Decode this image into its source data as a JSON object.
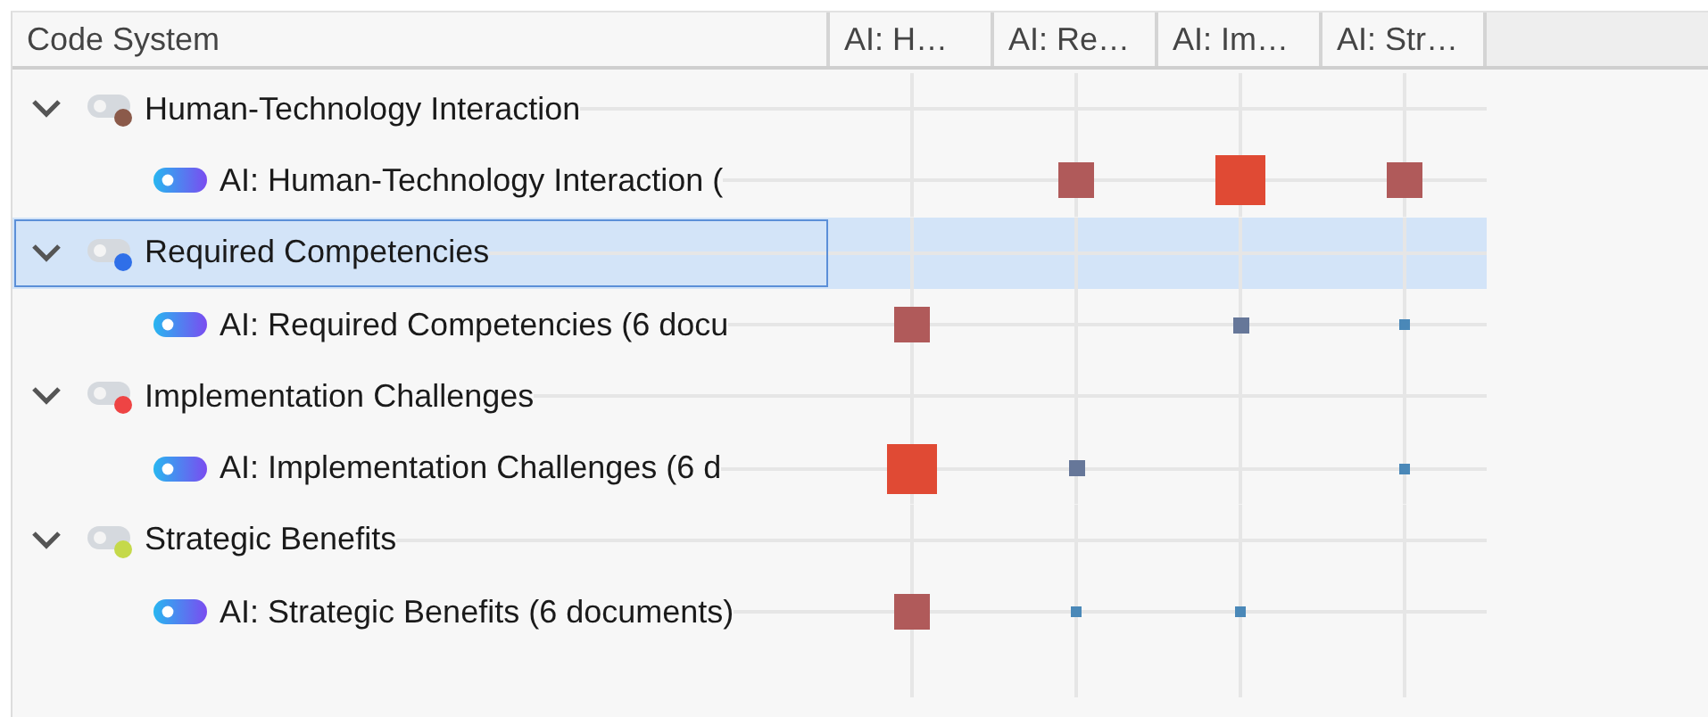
{
  "header": {
    "title": "Code System",
    "columns": [
      "AI: H…",
      "AI: Re…",
      "AI: Im…",
      "AI: Str…"
    ]
  },
  "codes": [
    {
      "label": "Human-Technology Interaction",
      "color": "#8b5a4a",
      "expanded": true,
      "selected": false,
      "children": [
        {
          "label": "AI: Human-Technology Interaction (",
          "selected": false,
          "cells": [
            {
              "kind": "empty"
            },
            {
              "kind": "medium"
            },
            {
              "kind": "large"
            },
            {
              "kind": "medium"
            }
          ]
        }
      ]
    },
    {
      "label": "Required Competencies",
      "color": "#2f6fe8",
      "expanded": true,
      "selected": true,
      "children": [
        {
          "label": "AI: Required Competencies (6 docu",
          "selected": false,
          "cells": [
            {
              "kind": "medium"
            },
            {
              "kind": "empty"
            },
            {
              "kind": "small"
            },
            {
              "kind": "tiny"
            }
          ]
        }
      ]
    },
    {
      "label": "Implementation Challenges",
      "color": "#ee4444",
      "expanded": true,
      "selected": false,
      "children": [
        {
          "label": "AI: Implementation Challenges (6 d",
          "selected": false,
          "cells": [
            {
              "kind": "large"
            },
            {
              "kind": "small"
            },
            {
              "kind": "empty"
            },
            {
              "kind": "tiny"
            }
          ]
        }
      ]
    },
    {
      "label": "Strategic Benefits",
      "color": "#c5d94a",
      "expanded": true,
      "selected": false,
      "children": [
        {
          "label": "AI: Strategic Benefits (6 documents)",
          "selected": false,
          "cells": [
            {
              "kind": "medium"
            },
            {
              "kind": "tiny"
            },
            {
              "kind": "tiny"
            },
            {
              "kind": "empty"
            }
          ]
        }
      ]
    }
  ]
}
